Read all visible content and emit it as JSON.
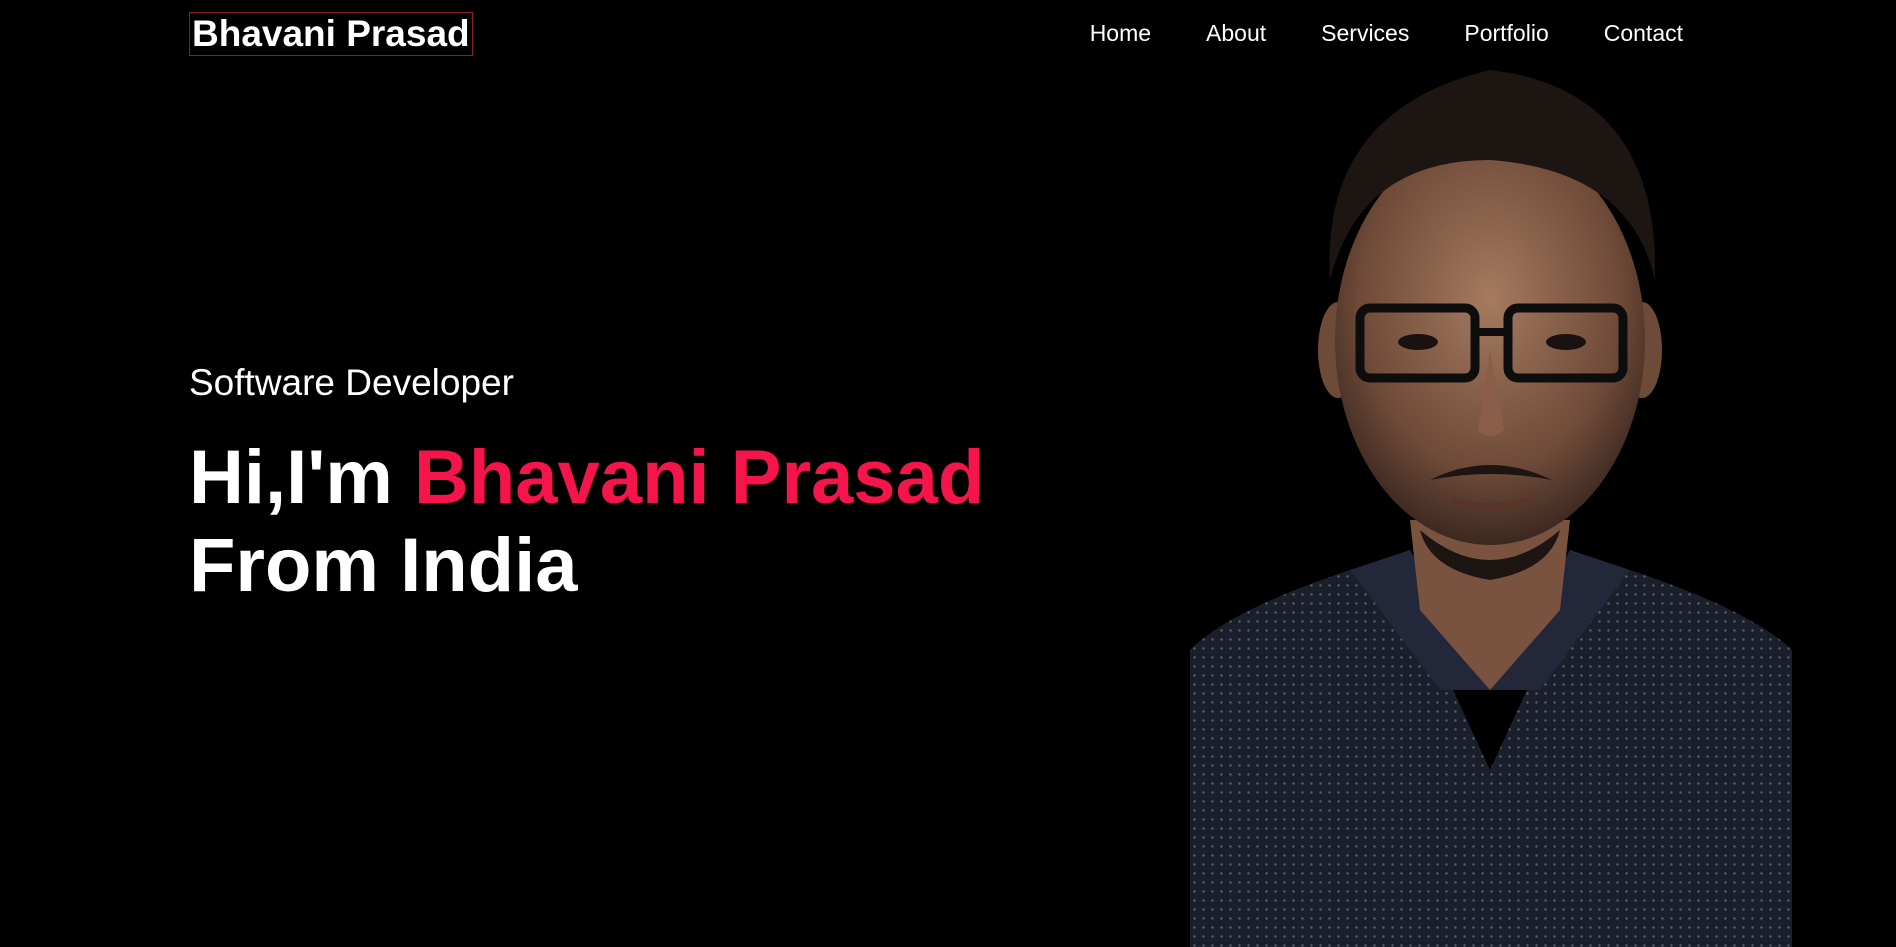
{
  "header": {
    "logo_text": "Bhavani Prasad",
    "nav": [
      {
        "label": "Home"
      },
      {
        "label": "About"
      },
      {
        "label": "Services"
      },
      {
        "label": "Portfolio"
      },
      {
        "label": "Contact"
      }
    ]
  },
  "hero": {
    "subtitle": "Software Developer",
    "greeting": "Hi,I'm ",
    "name": "Bhavani Prasad",
    "line2": "From India"
  },
  "colors": {
    "background": "#000000",
    "text": "#ffffff",
    "accent": "#f5154a",
    "logo_border": "#8b1d2c"
  }
}
